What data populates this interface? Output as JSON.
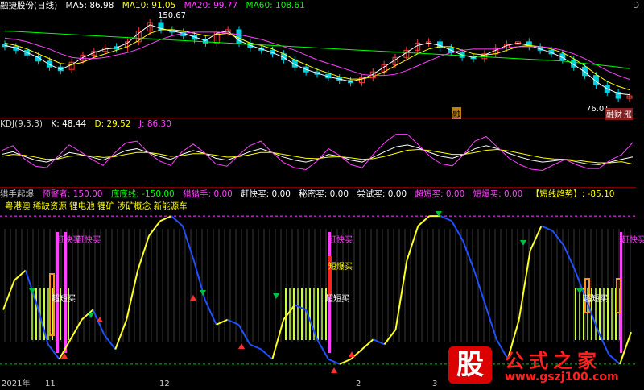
{
  "main": {
    "title": "融捷股份(日线)",
    "ma5": "MA5: 86.98",
    "ma10": "MA10: 91.05",
    "ma20": "MA20: 99.77",
    "ma60": "MA60: 108.61",
    "high_label": "150.67",
    "low_label": "76.01",
    "badge_a": "融",
    "badge_b": "融财",
    "badge_c": "涨",
    "corner": "D"
  },
  "kdj": {
    "title": "KDJ(9,3,3)",
    "k": "K: 48.44",
    "d": "D: 29.52",
    "j": "J: 86.30"
  },
  "ind": {
    "title": "猎手起爆",
    "alert": "预警者: 150.00",
    "bottom": "底底线: -150.00",
    "hunter": "猎猎手: 0.00",
    "quick": "赶快买: 0.00",
    "secret": "秘密买: 0.00",
    "try": "尝试买: 0.00",
    "ultra": "超短买: 0.00",
    "burst": "短爆买: 0.00",
    "trend": "【短线趋势】: -85.10",
    "concepts": "粤港澳 稀缺资源 锂电池 锂矿 涉矿概念 新能源车",
    "sig_quick": "赶快买",
    "sig_ultra": "超短买",
    "sig_burst": "短爆买"
  },
  "xaxis": {
    "labels": [
      "2021年",
      "11",
      "12",
      "2",
      "3"
    ]
  },
  "logo": {
    "big": "股",
    "title": "公式之家",
    "url": "www.gszj100.com"
  },
  "colors": {
    "up": "#ff3a3a",
    "down": "#00d0e0",
    "ma5": "#ffffff",
    "ma10": "#ffff00",
    "ma20": "#ff40ff",
    "ma60": "#00ff00",
    "k": "#ffffff",
    "d": "#ffff00",
    "j": "#ff40ff"
  },
  "chart_data": [
    {
      "type": "candlestick",
      "title": "融捷股份(日线)",
      "series": [
        {
          "name": "MA5",
          "values": [
            128,
            126,
            122,
            118,
            112,
            108,
            112,
            118,
            122,
            125,
            126,
            130,
            138,
            145,
            142,
            140,
            138,
            135,
            132,
            138,
            140,
            132,
            128,
            125,
            122,
            118,
            112,
            108,
            105,
            102,
            100,
            98,
            100,
            104,
            110,
            116,
            122,
            128,
            130,
            128,
            124,
            120,
            118,
            120,
            124,
            128,
            130,
            128,
            125,
            122,
            118,
            112,
            106,
            98,
            92,
            88,
            86.98
          ]
        },
        {
          "name": "MA10",
          "values": [
            130,
            128,
            125,
            121,
            117,
            113,
            112,
            114,
            118,
            121,
            124,
            127,
            132,
            138,
            141,
            141,
            140,
            138,
            136,
            137,
            138,
            134,
            130,
            128,
            125,
            121,
            116,
            112,
            108,
            105,
            102,
            100,
            100,
            102,
            106,
            111,
            116,
            121,
            125,
            127,
            127,
            124,
            121,
            120,
            121,
            124,
            127,
            128,
            127,
            125,
            122,
            117,
            111,
            104,
            98,
            94,
            91.05
          ]
        },
        {
          "name": "MA20",
          "values": [
            134,
            133,
            131,
            128,
            125,
            121,
            118,
            117,
            117,
            118,
            120,
            122,
            125,
            129,
            133,
            136,
            138,
            139,
            139,
            139,
            138,
            137,
            135,
            133,
            130,
            127,
            124,
            120,
            116,
            113,
            110,
            107,
            104,
            103,
            103,
            104,
            107,
            111,
            115,
            119,
            122,
            124,
            125,
            125,
            125,
            126,
            127,
            127,
            127,
            126,
            124,
            121,
            117,
            112,
            107,
            103,
            99.77
          ]
        },
        {
          "name": "MA60",
          "values": [
            140,
            139.5,
            139,
            138.5,
            138,
            137.5,
            137,
            136.5,
            136,
            135.5,
            135,
            134.5,
            134,
            133.5,
            133,
            132.5,
            132,
            131.5,
            131,
            130.5,
            130,
            129.5,
            129,
            128.5,
            128,
            127.5,
            127,
            126.5,
            126,
            125.5,
            125,
            124.5,
            124,
            123.5,
            123,
            122.5,
            122,
            121.5,
            121,
            120.5,
            120,
            119.5,
            119,
            118.5,
            118,
            117.5,
            117,
            116.5,
            116,
            115.5,
            115,
            114,
            113,
            112,
            111,
            110,
            108.61
          ]
        }
      ],
      "closes": [
        127,
        124,
        120,
        115,
        110,
        107,
        114,
        120,
        123,
        126,
        125,
        131,
        140,
        147,
        141,
        139,
        136,
        133,
        130,
        139,
        141,
        130,
        126,
        124,
        121,
        116,
        110,
        106,
        104,
        101,
        99,
        97,
        101,
        106,
        112,
        118,
        124,
        130,
        131,
        126,
        122,
        118,
        117,
        121,
        126,
        129,
        131,
        127,
        124,
        121,
        116,
        110,
        103,
        95,
        89,
        84,
        86
      ],
      "opens": [
        129,
        127,
        124,
        119,
        115,
        110,
        108,
        115,
        120,
        123,
        127,
        126,
        131,
        140,
        147,
        141,
        139,
        136,
        133,
        130,
        139,
        141,
        130,
        126,
        124,
        121,
        116,
        110,
        106,
        104,
        101,
        99,
        97,
        101,
        106,
        112,
        118,
        124,
        130,
        131,
        126,
        122,
        118,
        117,
        121,
        126,
        129,
        131,
        127,
        124,
        121,
        116,
        110,
        103,
        95,
        89,
        84
      ],
      "annotations": [
        "150.67",
        "76.01"
      ]
    },
    {
      "type": "line",
      "title": "KDJ(9,3,3)",
      "ylim": [
        -20,
        120
      ],
      "series": [
        {
          "name": "K",
          "values": [
            55,
            62,
            50,
            40,
            35,
            45,
            60,
            55,
            48,
            40,
            52,
            65,
            70,
            60,
            50,
            42,
            55,
            65,
            58,
            45,
            40,
            50,
            62,
            70,
            60,
            48,
            40,
            35,
            42,
            55,
            50,
            40,
            35,
            48,
            62,
            75,
            80,
            72,
            60,
            50,
            45,
            55,
            70,
            78,
            70,
            58,
            48,
            40,
            35,
            38,
            42,
            36,
            30,
            28,
            35,
            42,
            48.44
          ]
        },
        {
          "name": "D",
          "values": [
            50,
            55,
            53,
            48,
            42,
            43,
            50,
            52,
            51,
            47,
            49,
            55,
            60,
            60,
            56,
            50,
            52,
            57,
            57,
            53,
            48,
            49,
            54,
            60,
            60,
            55,
            50,
            45,
            44,
            48,
            49,
            46,
            42,
            44,
            50,
            58,
            66,
            68,
            65,
            60,
            55,
            55,
            60,
            66,
            68,
            64,
            58,
            52,
            46,
            43,
            42,
            40,
            36,
            33,
            33,
            36,
            29.52
          ]
        },
        {
          "name": "J",
          "values": [
            65,
            78,
            44,
            24,
            20,
            50,
            80,
            62,
            42,
            26,
            58,
            85,
            90,
            60,
            38,
            26,
            62,
            82,
            60,
            30,
            24,
            52,
            78,
            90,
            60,
            34,
            20,
            15,
            38,
            70,
            52,
            28,
            20,
            56,
            86,
            108,
            108,
            80,
            50,
            30,
            25,
            55,
            90,
            102,
            74,
            46,
            28,
            16,
            13,
            28,
            42,
            28,
            18,
            18,
            40,
            54,
            86.3
          ]
        }
      ]
    },
    {
      "type": "line",
      "title": "猎手起爆",
      "series": [
        {
          "name": "预警者",
          "values": [
            150
          ]
        },
        {
          "name": "底底线",
          "values": [
            -150
          ]
        },
        {
          "name": "短线趋势",
          "values": [
            -40,
            20,
            40,
            -30,
            -110,
            -140,
            -100,
            -60,
            -40,
            -90,
            -120,
            -60,
            40,
            110,
            140,
            150,
            130,
            60,
            -20,
            -70,
            -60,
            -70,
            -110,
            -120,
            -140,
            -60,
            -30,
            -40,
            -100,
            -140,
            -150,
            -140,
            -120,
            -100,
            -110,
            -80,
            60,
            130,
            150,
            150,
            140,
            100,
            40,
            -30,
            -100,
            -140,
            -60,
            80,
            130,
            120,
            90,
            40,
            -20,
            -80,
            -130,
            -150,
            -85.1
          ]
        }
      ]
    }
  ]
}
